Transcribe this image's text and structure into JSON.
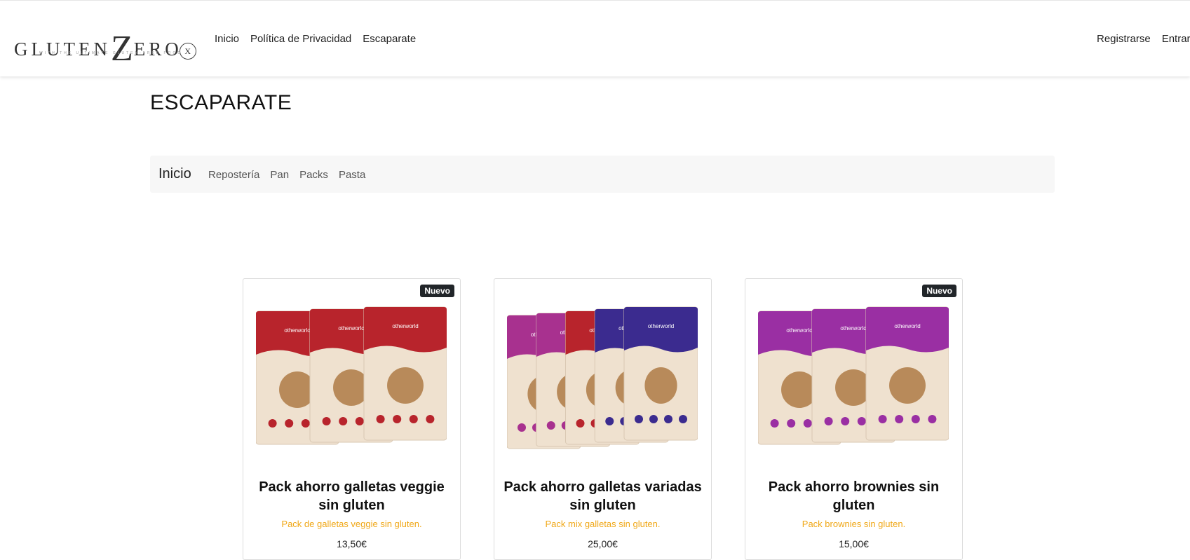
{
  "brand": {
    "name_part1": "GLUTEN",
    "name_big": "Z",
    "name_part2": "ERO",
    "mark": "X",
    "tagline": "WITH THE ULTIMATE GLUTEN-FREE FOOD"
  },
  "nav": {
    "links": [
      "Inicio",
      "Política de Privacidad",
      "Escaparate"
    ],
    "right": [
      "Registrarse",
      "Entrar"
    ]
  },
  "page": {
    "title": "ESCAPARATE"
  },
  "categories": {
    "home": "Inicio",
    "items": [
      "Repostería",
      "Pan",
      "Packs",
      "Pasta"
    ]
  },
  "products": [
    {
      "badge": "Nuevo",
      "title": "Pack ahorro galletas veggie sin gluten",
      "description": "Pack de galletas veggie sin gluten.",
      "price": "13,50€",
      "bag_colors": [
        "#b8242c",
        "#b8242c",
        "#b8242c"
      ],
      "bag_label": "otherworld"
    },
    {
      "badge": "",
      "title": "Pack ahorro galletas variadas sin gluten",
      "description": "Pack mix galletas sin gluten.",
      "price": "25,00€",
      "bag_colors": [
        "#a8318f",
        "#a8318f",
        "#b8242c",
        "#3b2b8f",
        "#3b2b8f"
      ],
      "bag_label": "otherworld"
    },
    {
      "badge": "Nuevo",
      "title": "Pack ahorro brownies sin gluten",
      "description": "Pack brownies sin gluten.",
      "price": "15,00€",
      "bag_colors": [
        "#9a2fa3",
        "#9a2fa3",
        "#9a2fa3"
      ],
      "bag_label": "otherworld"
    }
  ]
}
